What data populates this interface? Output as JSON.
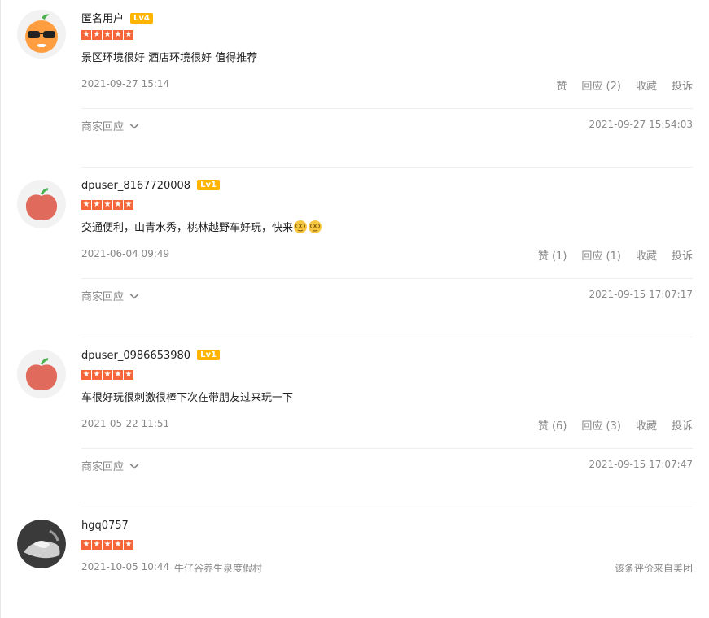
{
  "reviews": [
    {
      "username": "匿名用户",
      "level": "Lv4",
      "content": "景区环境很好 酒店环境很好 值得推荐",
      "date": "2021-09-27 15:14",
      "like": "赞",
      "reply": "回应 (2)",
      "fav": "收藏",
      "report": "投诉",
      "biz_reply": "商家回应",
      "biz_time": "2021-09-27 15:54:03"
    },
    {
      "username": "dpuser_8167720008",
      "level": "Lv1",
      "content": "交通便利，山青水秀，桃林越野车好玩，快来",
      "date": "2021-06-04 09:49",
      "like": "赞 (1)",
      "reply": "回应 (1)",
      "fav": "收藏",
      "report": "投诉",
      "biz_reply": "商家回应",
      "biz_time": "2021-09-15 17:07:17"
    },
    {
      "username": "dpuser_0986653980",
      "level": "Lv1",
      "content": "车很好玩很刺激很棒下次在带朋友过来玩一下",
      "date": "2021-05-22 11:51",
      "like": "赞 (6)",
      "reply": "回应 (3)",
      "fav": "收藏",
      "report": "投诉",
      "biz_reply": "商家回应",
      "biz_time": "2021-09-15 17:07:47"
    },
    {
      "username": "hgq0757",
      "date": "2021-10-05 10:44",
      "shop": "牛仔谷养生泉度假村",
      "source": "该条评价来自美团"
    }
  ],
  "colors": {
    "star": "#f5673b",
    "level_badge": "#ffb400"
  },
  "icons": [
    "sunglasses-orange-avatar-icon",
    "apple-avatar-icon",
    "photo-avatar-icon",
    "star-icon",
    "chevron-down-icon",
    "smile-emoji-icon"
  ]
}
